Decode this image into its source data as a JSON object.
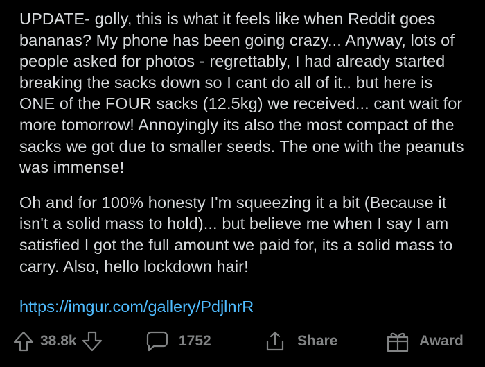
{
  "post": {
    "paragraphs": [
      "UPDATE- golly, this is what it feels like when Reddit goes bananas? My phone has been going crazy... Anyway, lots of people asked for photos - regrettably, I had already started breaking the sacks down so I cant do all of it.. but here is ONE of the FOUR sacks (12.5kg) we received... cant wait for more tomorrow! Annoyingly its also the most compact of the sacks we got due to smaller seeds. The one with the peanuts was immense!",
      "Oh and for 100% honesty I'm squeezing it a bit (Because it isn't a solid mass to hold)... but believe me when I say I am satisfied I got the full amount we paid for, its a solid mass to carry. Also, hello lockdown hair!"
    ],
    "link": "https://imgur.com/gallery/PdjlnrR"
  },
  "actions": {
    "vote_count": "38.8k",
    "comment_count": "1752",
    "share_label": "Share",
    "award_label": "Award"
  },
  "icons": {
    "upvote": "arrow-up-icon",
    "downvote": "arrow-down-icon",
    "comment": "speech-bubble-icon",
    "share": "share-icon",
    "award": "gift-icon"
  },
  "colors": {
    "background": "#000000",
    "text": "#d7dadc",
    "link": "#4fbcff",
    "muted": "#818384"
  }
}
